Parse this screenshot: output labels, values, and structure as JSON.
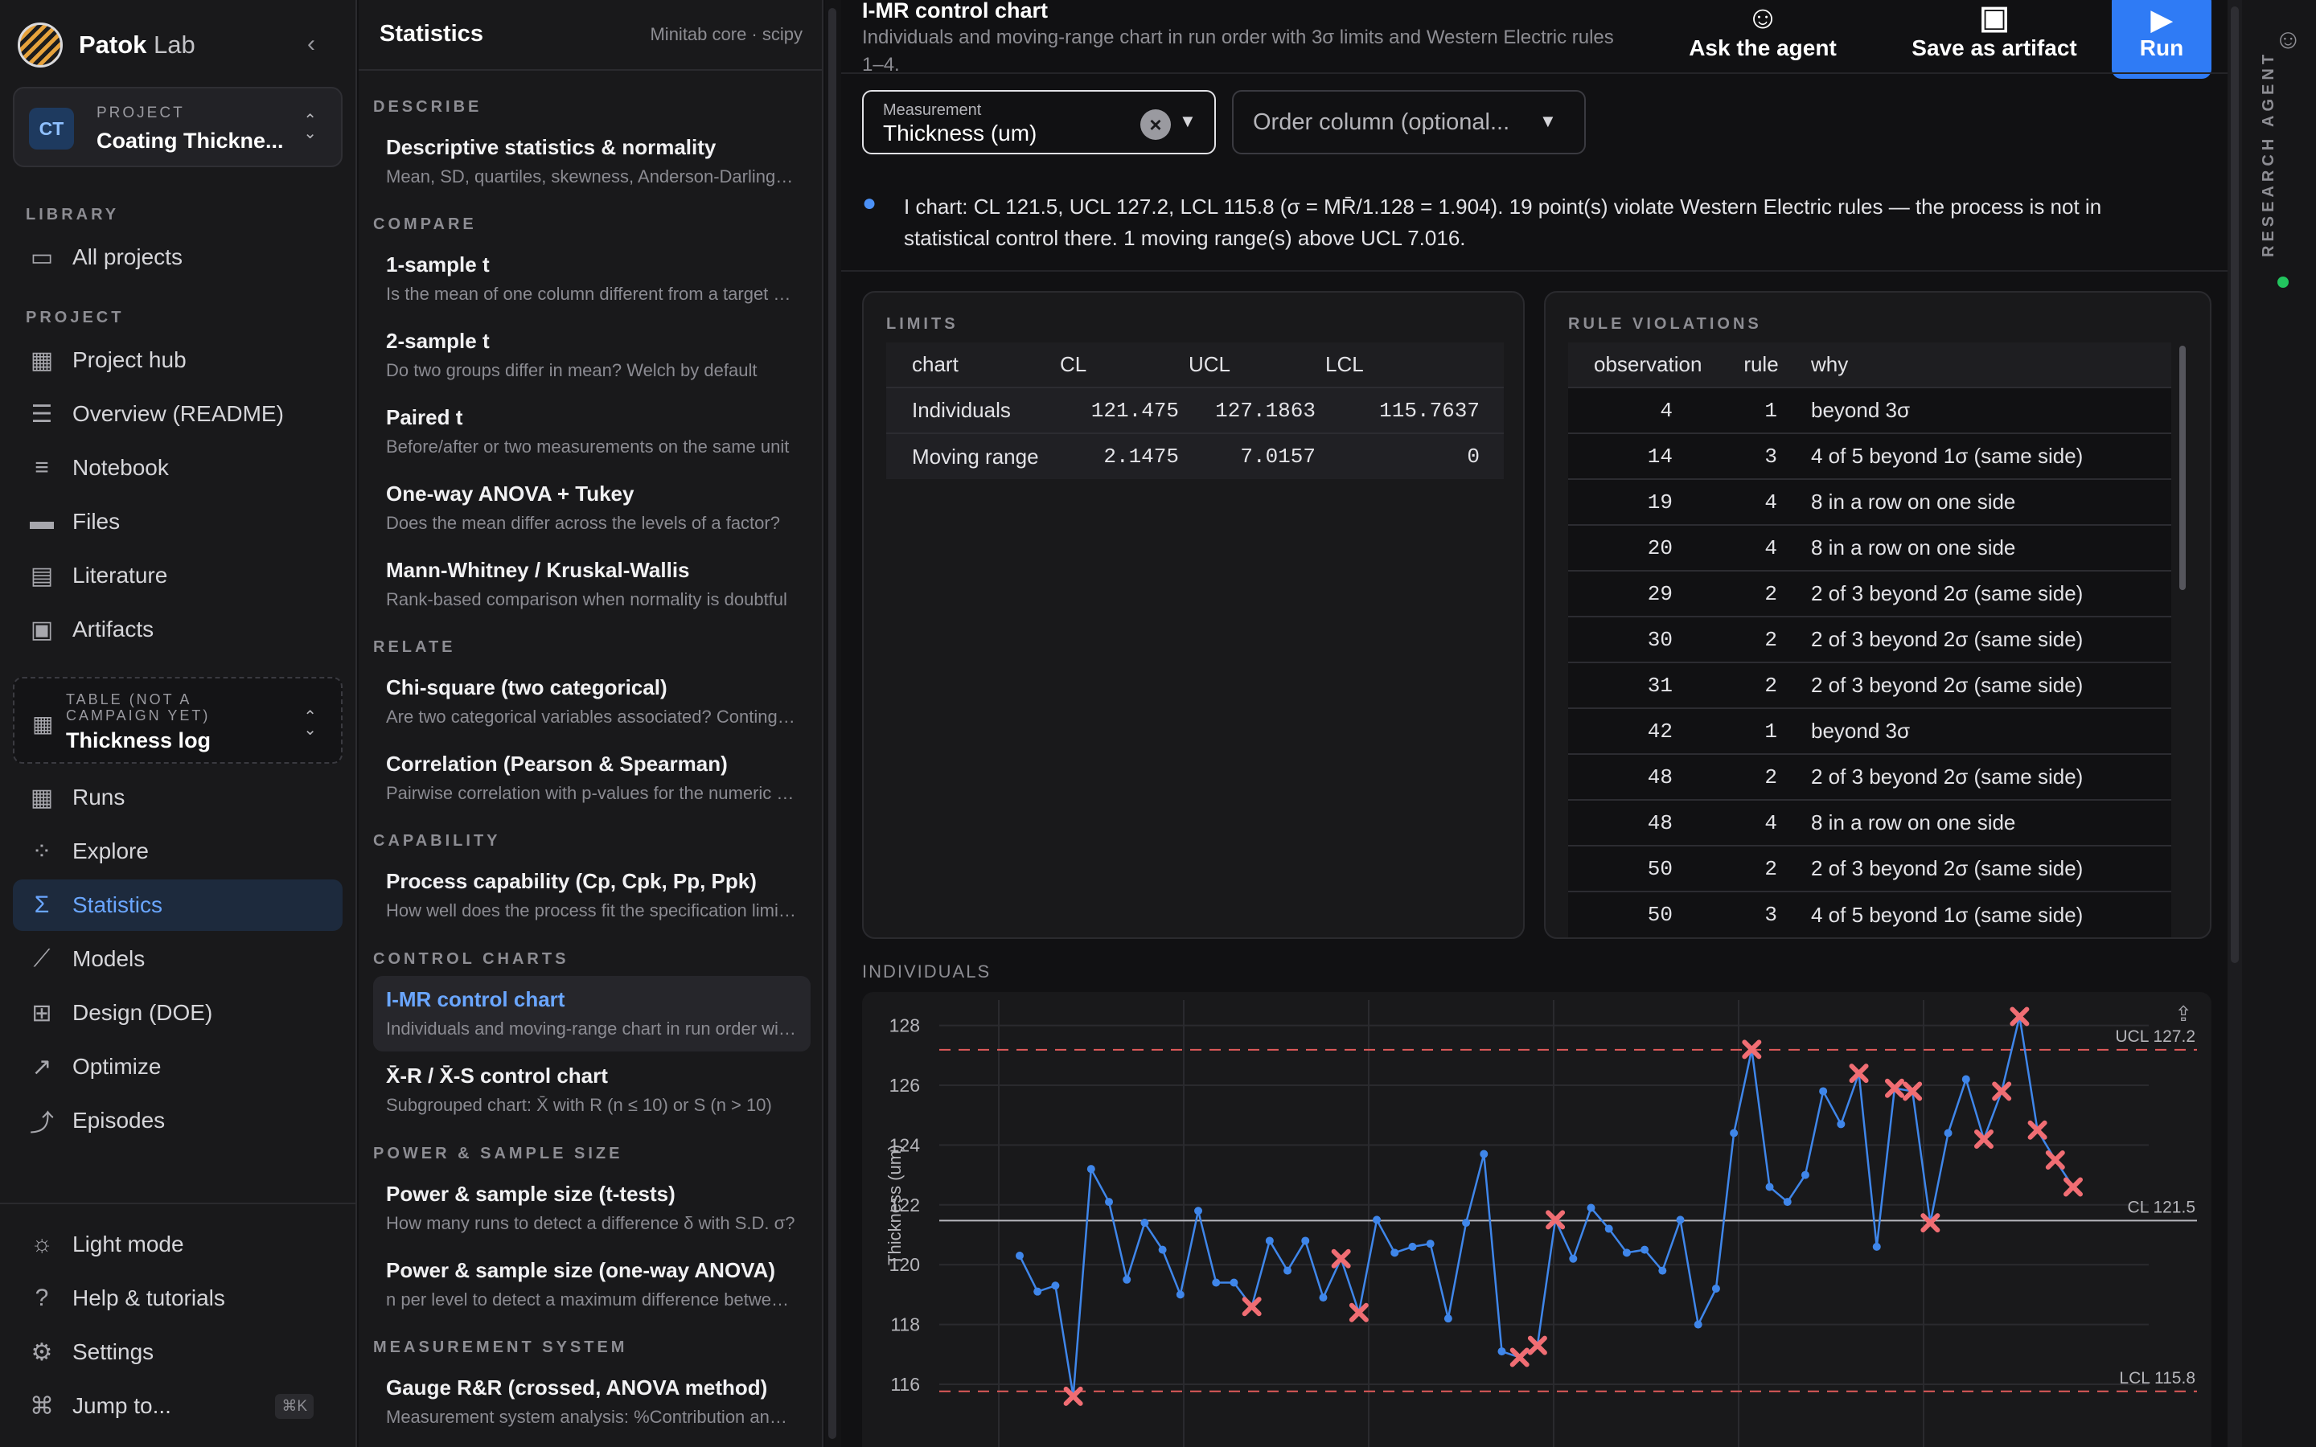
{
  "brand": {
    "name": "Patok",
    "suffix": " Lab"
  },
  "project": {
    "avatar": "CT",
    "kicker": "PROJECT",
    "name": "Coating Thickne..."
  },
  "library": {
    "label": "LIBRARY",
    "items": [
      {
        "label": "All projects",
        "icon": "folder-icon"
      }
    ]
  },
  "project_nav": {
    "label": "PROJECT",
    "items": [
      {
        "label": "Project hub",
        "icon": "grid-icon"
      },
      {
        "label": "Overview (README)",
        "icon": "document-icon"
      },
      {
        "label": "Notebook",
        "icon": "notebook-icon"
      },
      {
        "label": "Files",
        "icon": "files-icon"
      },
      {
        "label": "Literature",
        "icon": "book-icon"
      },
      {
        "label": "Artifacts",
        "icon": "archive-icon"
      }
    ]
  },
  "table_card": {
    "kicker": "TABLE (NOT A CAMPAIGN YET)",
    "name": "Thickness log"
  },
  "tools_nav": [
    {
      "label": "Runs",
      "icon": "table-icon"
    },
    {
      "label": "Explore",
      "icon": "scatter-icon"
    },
    {
      "label": "Statistics",
      "icon": "sigma-icon"
    },
    {
      "label": "Models",
      "icon": "models-icon"
    },
    {
      "label": "Design (DOE)",
      "icon": "design-grid-icon"
    },
    {
      "label": "Optimize",
      "icon": "trend-icon"
    },
    {
      "label": "Episodes",
      "icon": "episodes-icon"
    }
  ],
  "bottom_nav": [
    {
      "label": "Light mode",
      "icon": "sun-icon"
    },
    {
      "label": "Help & tutorials",
      "icon": "help-icon"
    },
    {
      "label": "Settings",
      "icon": "gear-icon"
    },
    {
      "label": "Jump to...",
      "icon": "command-icon",
      "kbd": "⌘K"
    }
  ],
  "stats": {
    "title": "Statistics",
    "subtitle": "Minitab core · scipy",
    "sections": [
      {
        "label": "DESCRIBE",
        "items": [
          {
            "title": "Descriptive statistics & normality",
            "desc": "Mean, SD, quartiles, skewness, Anderson-Darling normality test"
          }
        ]
      },
      {
        "label": "COMPARE",
        "items": [
          {
            "title": "1-sample t",
            "desc": "Is the mean of one column different from a target value?"
          },
          {
            "title": "2-sample t",
            "desc": "Do two groups differ in mean? Welch by default"
          },
          {
            "title": "Paired t",
            "desc": "Before/after or two measurements on the same unit"
          },
          {
            "title": "One-way ANOVA + Tukey",
            "desc": "Does the mean differ across the levels of a factor?"
          },
          {
            "title": "Mann-Whitney / Kruskal-Wallis",
            "desc": "Rank-based comparison when normality is doubtful"
          }
        ]
      },
      {
        "label": "RELATE",
        "items": [
          {
            "title": "Chi-square (two categorical)",
            "desc": "Are two categorical variables associated? Contingency table"
          },
          {
            "title": "Correlation (Pearson & Spearman)",
            "desc": "Pairwise correlation with p-values for the numeric columns"
          }
        ]
      },
      {
        "label": "CAPABILITY",
        "items": [
          {
            "title": "Process capability (Cp, Cpk, Pp, Ppk)",
            "desc": "How well does the process fit the specification limits?"
          }
        ]
      },
      {
        "label": "CONTROL CHARTS",
        "items": [
          {
            "title": "I-MR control chart",
            "desc": "Individuals and moving-range chart in run order with limits"
          },
          {
            "title": "X̄-R / X̄-S control chart",
            "desc": "Subgrouped chart: X̄ with R (n ≤ 10) or S (n > 10)"
          }
        ]
      },
      {
        "label": "POWER & SAMPLE SIZE",
        "items": [
          {
            "title": "Power & sample size (t-tests)",
            "desc": "How many runs to detect a difference δ with S.D. σ?"
          },
          {
            "title": "Power & sample size (one-way ANOVA)",
            "desc": "n per level to detect a maximum difference between means"
          }
        ]
      },
      {
        "label": "MEASUREMENT SYSTEM",
        "items": [
          {
            "title": "Gauge R&R (crossed, ANOVA method)",
            "desc": "Measurement system analysis: %Contribution and %Study Var"
          }
        ]
      }
    ]
  },
  "main": {
    "title": "I-MR control chart",
    "description": "Individuals and moving-range chart in run order with 3σ limits and Western Electric rules 1–4.",
    "ask_label": "Ask the agent",
    "save_label": "Save as artifact",
    "run_label": "Run",
    "measurement_label": "Measurement",
    "measurement_value": "Thickness (um)",
    "order_placeholder": "Order column (optional...",
    "insight": "I chart: CL 121.5, UCL 127.2, LCL 115.8 (σ = MR̄/1.128 = 1.904). 19 point(s) violate Western Electric rules — the process is not in statistical control there. 1 moving range(s) above UCL 7.016."
  },
  "limits": {
    "label": "LIMITS",
    "columns": [
      "chart",
      "CL",
      "UCL",
      "LCL"
    ],
    "rows": [
      [
        "Individuals",
        "121.475",
        "127.1863",
        "115.7637"
      ],
      [
        "Moving range",
        "2.1475",
        "7.0157",
        "0"
      ]
    ]
  },
  "violations": {
    "label": "RULE VIOLATIONS",
    "columns": [
      "observation",
      "rule",
      "why"
    ],
    "rows": [
      [
        "4",
        "1",
        "beyond 3σ"
      ],
      [
        "14",
        "3",
        "4 of 5 beyond 1σ (same side)"
      ],
      [
        "19",
        "4",
        "8 in a row on one side"
      ],
      [
        "20",
        "4",
        "8 in a row on one side"
      ],
      [
        "29",
        "2",
        "2 of 3 beyond 2σ (same side)"
      ],
      [
        "30",
        "2",
        "2 of 3 beyond 2σ (same side)"
      ],
      [
        "31",
        "2",
        "2 of 3 beyond 2σ (same side)"
      ],
      [
        "42",
        "1",
        "beyond 3σ"
      ],
      [
        "48",
        "2",
        "2 of 3 beyond 2σ (same side)"
      ],
      [
        "48",
        "4",
        "8 in a row on one side"
      ],
      [
        "50",
        "2",
        "2 of 3 beyond 2σ (same side)"
      ],
      [
        "50",
        "3",
        "4 of 5 beyond 1σ (same side)"
      ]
    ]
  },
  "chart_section_label": "INDIVIDUALS",
  "chart_data": {
    "type": "line",
    "ylabel": "Thickness (um)",
    "ylim": [
      115.6,
      128.6
    ],
    "yticks": [
      116,
      118,
      120,
      122,
      124,
      126,
      128
    ],
    "grid": true,
    "x": [
      1,
      2,
      3,
      4,
      5,
      6,
      7,
      8,
      9,
      10,
      11,
      12,
      13,
      14,
      15,
      16,
      17,
      18,
      19,
      20,
      21,
      22,
      23,
      24,
      25,
      26,
      27,
      28,
      29,
      30,
      31,
      32,
      33,
      34,
      35,
      36,
      37,
      38,
      39,
      40,
      41,
      42,
      43,
      44,
      45,
      46,
      47,
      48,
      49,
      50,
      51,
      52,
      53,
      54,
      55,
      56,
      57,
      58,
      59,
      60
    ],
    "series": [
      {
        "values": [
          120.3,
          119.1,
          119.3,
          115.6,
          123.2,
          122.1,
          119.5,
          121.4,
          120.5,
          119.0,
          121.8,
          119.4,
          119.4,
          118.6,
          120.8,
          119.8,
          120.8,
          118.9,
          120.2,
          118.4,
          121.5,
          120.4,
          120.6,
          120.7,
          118.2,
          121.4,
          123.7,
          117.1,
          116.9,
          117.3,
          121.5,
          120.2,
          121.9,
          121.2,
          120.4,
          120.5,
          119.8,
          121.5,
          118.0,
          119.2,
          124.4,
          127.2,
          122.6,
          122.1,
          123.0,
          125.8,
          124.7,
          126.4,
          120.6,
          125.9,
          125.8,
          121.4,
          124.4,
          126.2,
          124.2,
          125.8,
          128.3,
          124.5,
          123.5,
          122.6
        ],
        "violations_x": [
          4,
          14,
          19,
          20,
          29,
          30,
          31,
          42,
          48,
          50,
          51,
          52,
          55,
          56,
          57,
          58,
          59,
          60
        ]
      }
    ],
    "ref_lines": [
      {
        "label": "UCL 127.2",
        "value": 127.186
      },
      {
        "label": "CL 121.5",
        "value": 121.475
      },
      {
        "label": "LCL 115.8",
        "value": 115.764
      }
    ]
  },
  "rail": {
    "label": "RESEARCH AGENT"
  }
}
